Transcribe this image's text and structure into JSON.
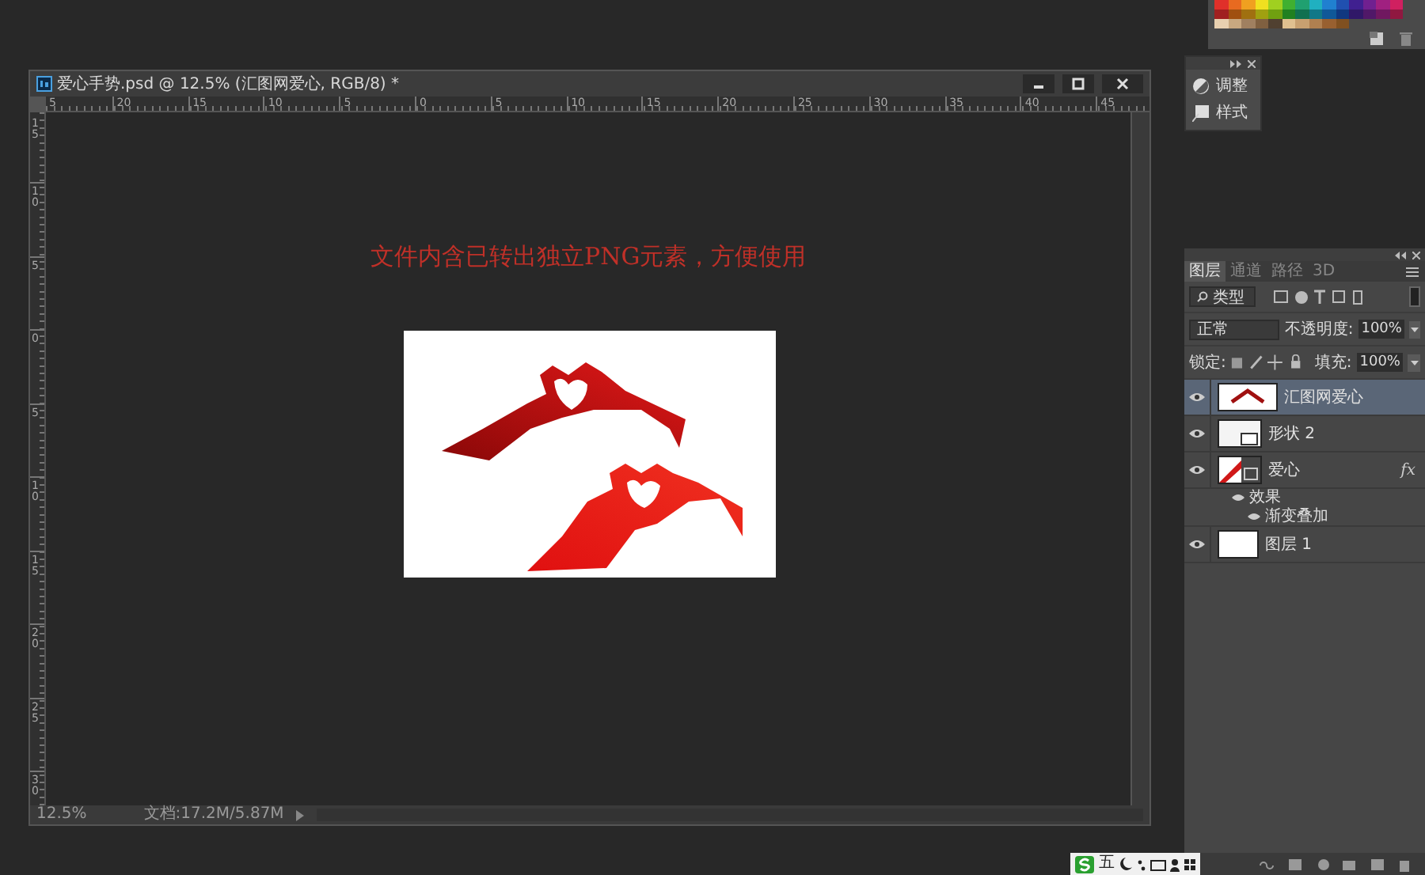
{
  "document": {
    "title": "爱心手势.psd @ 12.5% (汇图网爱心, RGB/8) *",
    "ruler_h": [
      "5",
      "20",
      "15",
      "10",
      "5",
      "0",
      "5",
      "10",
      "15",
      "20",
      "25",
      "30",
      "35",
      "40",
      "45"
    ],
    "ruler_v": [
      "15",
      "10",
      "5",
      "0",
      "5",
      "10",
      "15",
      "20",
      "25",
      "30"
    ],
    "caption": "文件内含已转出独立PNG元素，方便使用",
    "zoom": "12.5%",
    "doc_info": "文档:17.2M/5.87M"
  },
  "adjust_panel": {
    "items": [
      {
        "label": "调整",
        "kind": "adjust"
      },
      {
        "label": "样式",
        "kind": "style"
      }
    ]
  },
  "layers_panel": {
    "tabs": [
      {
        "label": "图层",
        "selected": true
      },
      {
        "label": "通道",
        "selected": false
      },
      {
        "label": "路径",
        "selected": false
      },
      {
        "label": "3D",
        "selected": false
      }
    ],
    "filter": "类型",
    "blend_mode": "正常",
    "opacity_label": "不透明度:",
    "opacity": "100%",
    "lock_label": "锁定:",
    "fill_label": "填充:",
    "fill": "100%",
    "layers": [
      {
        "name": "汇图网爱心",
        "kind": "hearts",
        "selected": true,
        "visible": true
      },
      {
        "name": "形状 2",
        "kind": "shape",
        "selected": false,
        "visible": true
      },
      {
        "name": "爱心",
        "kind": "effect",
        "selected": false,
        "visible": true,
        "fx_label": "fx",
        "children": [
          {
            "name": "效果",
            "visible": true,
            "children": [
              {
                "name": "渐变叠加",
                "visible": true
              }
            ]
          }
        ]
      },
      {
        "name": "图层 1",
        "kind": "white",
        "selected": false,
        "visible": true
      }
    ]
  },
  "ime": {
    "label": "五"
  }
}
